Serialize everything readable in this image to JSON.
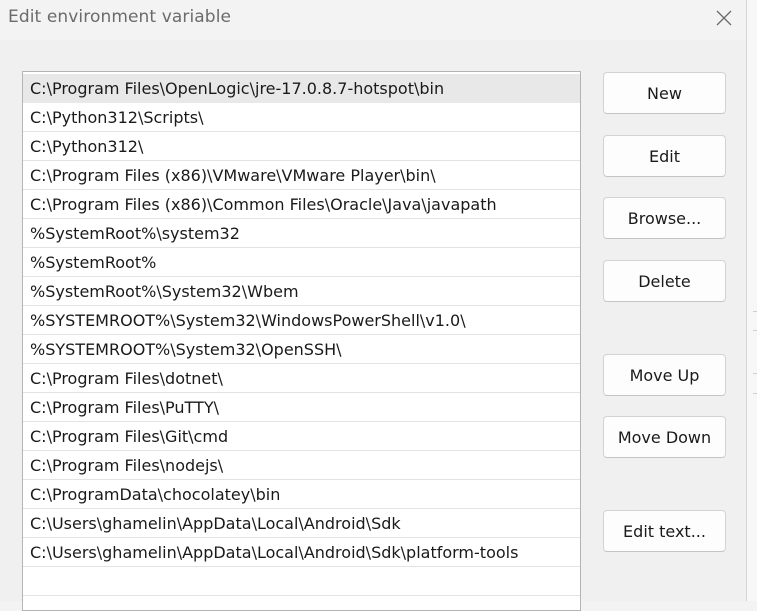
{
  "dialog": {
    "title": "Edit environment variable",
    "close_icon": "close-icon"
  },
  "path_list": {
    "selected_index": 0,
    "items": [
      "C:\\Program Files\\OpenLogic\\jre-17.0.8.7-hotspot\\bin",
      "C:\\Python312\\Scripts\\",
      "C:\\Python312\\",
      "C:\\Program Files (x86)\\VMware\\VMware Player\\bin\\",
      "C:\\Program Files (x86)\\Common Files\\Oracle\\Java\\javapath",
      "%SystemRoot%\\system32",
      "%SystemRoot%",
      "%SystemRoot%\\System32\\Wbem",
      "%SYSTEMROOT%\\System32\\WindowsPowerShell\\v1.0\\",
      "%SYSTEMROOT%\\System32\\OpenSSH\\",
      "C:\\Program Files\\dotnet\\",
      "C:\\Program Files\\PuTTY\\",
      "C:\\Program Files\\Git\\cmd",
      "C:\\Program Files\\nodejs\\",
      "C:\\ProgramData\\chocolatey\\bin",
      "C:\\Users\\ghamelin\\AppData\\Local\\Android\\Sdk",
      "C:\\Users\\ghamelin\\AppData\\Local\\Android\\Sdk\\platform-tools",
      ""
    ]
  },
  "buttons": {
    "new": "New",
    "edit": "Edit",
    "browse": "Browse...",
    "delete": "Delete",
    "move_up": "Move Up",
    "move_down": "Move Down",
    "edit_text": "Edit text..."
  },
  "colors": {
    "selected_row": "#e8e8e8",
    "list_border": "#b4b4b4",
    "background": "#f0f0f0"
  }
}
